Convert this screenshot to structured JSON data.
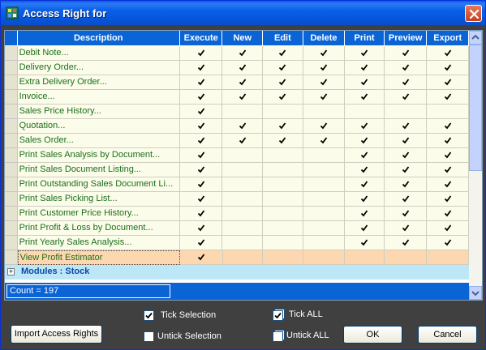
{
  "window": {
    "title": "Access Right for"
  },
  "columns": [
    "Description",
    "Execute",
    "New",
    "Edit",
    "Delete",
    "Print",
    "Preview",
    "Export"
  ],
  "rows": [
    {
      "label": "Debit Note...",
      "checks": [
        true,
        true,
        true,
        true,
        true,
        true,
        true
      ]
    },
    {
      "label": "Delivery Order...",
      "checks": [
        true,
        true,
        true,
        true,
        true,
        true,
        true
      ]
    },
    {
      "label": "Extra Delivery Order...",
      "checks": [
        true,
        true,
        true,
        true,
        true,
        true,
        true
      ]
    },
    {
      "label": "Invoice...",
      "checks": [
        true,
        true,
        true,
        true,
        true,
        true,
        true
      ]
    },
    {
      "label": "Sales Price History...",
      "checks": [
        true,
        false,
        false,
        false,
        false,
        false,
        false
      ]
    },
    {
      "label": "Quotation...",
      "checks": [
        true,
        true,
        true,
        true,
        true,
        true,
        true
      ]
    },
    {
      "label": "Sales Order...",
      "checks": [
        true,
        true,
        true,
        true,
        true,
        true,
        true
      ]
    },
    {
      "label": "Print Sales Analysis by Document...",
      "checks": [
        true,
        false,
        false,
        false,
        true,
        true,
        true
      ]
    },
    {
      "label": "Print Sales Document Listing...",
      "checks": [
        true,
        false,
        false,
        false,
        true,
        true,
        true
      ]
    },
    {
      "label": "Print Outstanding Sales Document Li...",
      "checks": [
        true,
        false,
        false,
        false,
        true,
        true,
        true
      ]
    },
    {
      "label": "Print Sales Picking List...",
      "checks": [
        true,
        false,
        false,
        false,
        true,
        true,
        true
      ]
    },
    {
      "label": "Print Customer Price History...",
      "checks": [
        true,
        false,
        false,
        false,
        true,
        true,
        true
      ]
    },
    {
      "label": "Print Profit & Loss by Document...",
      "checks": [
        true,
        false,
        false,
        false,
        true,
        true,
        true
      ]
    },
    {
      "label": "Print Yearly Sales Analysis...",
      "checks": [
        true,
        false,
        false,
        false,
        true,
        true,
        true
      ]
    },
    {
      "label": "View Profit Estimator",
      "checks": [
        true,
        false,
        false,
        false,
        false,
        false,
        false
      ],
      "selected": true
    }
  ],
  "group": {
    "expander": "+",
    "label": "Modules : Stock"
  },
  "footer": {
    "count": "Count = 197"
  },
  "controls": {
    "tick_selection": "Tick  Selection",
    "untick_selection": "Untick Selection",
    "tick_all": "Tick  ALL",
    "untick_all": "Untick ALL",
    "import_button": "Import Access Rights",
    "ok_button": "OK",
    "cancel_button": "Cancel"
  }
}
